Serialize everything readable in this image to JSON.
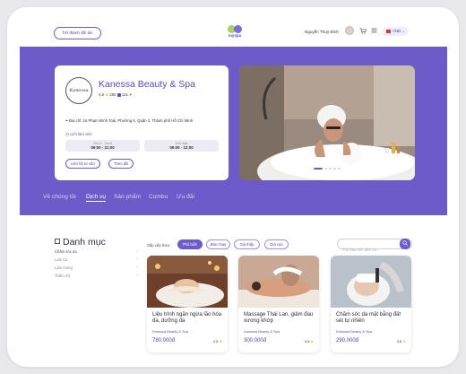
{
  "header": {
    "partner_button": "Trở thành đối tác",
    "logo_text": "myspa",
    "user_name": "Nguyễn Thuỳ Bình",
    "currency": "VND"
  },
  "spa": {
    "logo_text": "Kanessa",
    "name": "Kanessa Beauty & Spa",
    "rating": "4.5",
    "reviews": "250",
    "likes": "121",
    "address": "Địa chỉ: 16 Phạm Đình Toái, Phường 6, Quận 3, Thành phố Hồ Chí Minh",
    "schedule_label": "Lịch làm việc",
    "schedule": [
      {
        "days": "Thứ 2 - Thứ 6",
        "hours": "09:00 - 21:00"
      },
      {
        "days": "Chủ nhật",
        "hours": "09:00 - 12:00"
      }
    ],
    "contact_button": "Liên hệ tư vấn",
    "follow_button": "Theo dõi"
  },
  "carousel": {
    "count": 5,
    "active": 0
  },
  "tabs": [
    "Về chúng tôi",
    "Dịch vụ",
    "Sản phẩm",
    "Combo",
    "Ưu đãi"
  ],
  "active_tab": 1,
  "catalog": {
    "title": "Danh mục",
    "items": [
      "Chăm sóc da",
      "Làm tóc",
      "Làm móng",
      "Thẩm mỹ"
    ],
    "active": 0
  },
  "sort": {
    "label": "Sắp xếp theo:",
    "options": [
      "Phổ biến",
      "Bán chạy",
      "Giá thấp",
      "Giá cao"
    ],
    "active": 0
  },
  "search": {
    "placeholder": "Tìm theo tên dịch vụ"
  },
  "products": [
    {
      "name": "Liệu trình ngăn ngừa lão hóa da, dưỡng da",
      "spa": "Kanessa Beauty & Spa",
      "price": "780.000đ",
      "rating": "4.5"
    },
    {
      "name": "Massage Thái Lan, giảm đau xương khớp",
      "spa": "Kanessa Beauty & Spa",
      "price": "300.000đ",
      "rating": "4.5"
    },
    {
      "name": "Chăm sóc da mặt bằng đất sét tự nhiên",
      "spa": "Kanessa Beauty & Spa",
      "price": "290.000đ",
      "rating": "4.5"
    }
  ],
  "colors": {
    "primary": "#6c5bc9",
    "star": "#f3b72b"
  }
}
